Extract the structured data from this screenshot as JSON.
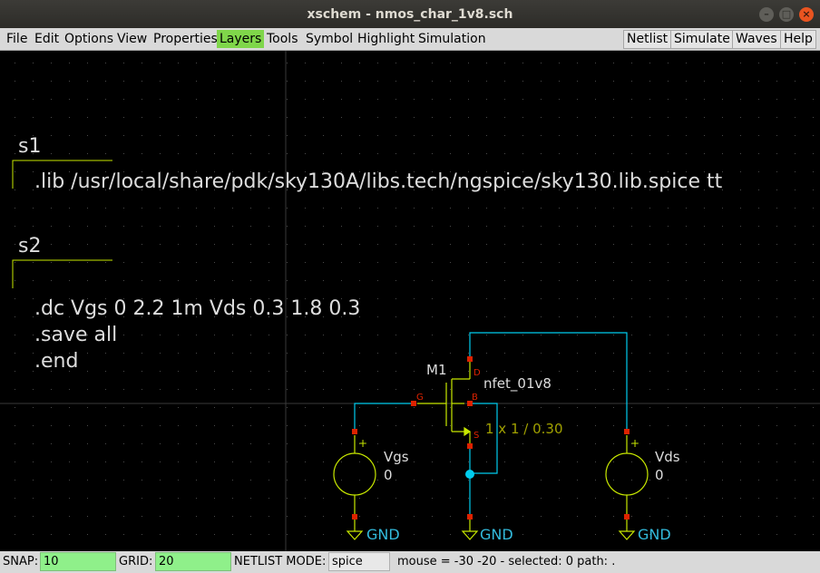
{
  "window": {
    "title": "xschem - nmos_char_1v8.sch"
  },
  "menu": {
    "items": [
      "File",
      "Edit",
      "Options",
      "View",
      "Properties",
      "Layers",
      "Tools",
      "Symbol",
      "Highlight",
      "Simulation"
    ],
    "active": "Layers",
    "right_buttons": [
      "Netlist",
      "Simulate",
      "Waves",
      "Help"
    ]
  },
  "schematic": {
    "code_blocks": [
      {
        "name": "s1",
        "lines": [
          ".lib /usr/local/share/pdk/sky130A/libs.tech/ngspice/sky130.lib.spice tt"
        ]
      },
      {
        "name": "s2",
        "lines": [
          ".dc Vgs 0 2.2 1m Vds 0.3 1.8 0.3",
          ".save all",
          ".end"
        ]
      }
    ],
    "transistor": {
      "name": "M1",
      "model": "nfet_01v8",
      "size": "1 x 1 / 0.30",
      "pins": [
        "D",
        "G",
        "B",
        "S"
      ]
    },
    "sources": [
      {
        "name": "Vgs",
        "value": "0"
      },
      {
        "name": "Vds",
        "value": "0"
      }
    ],
    "ground_label": "GND",
    "colors": {
      "wire": "#00ccee",
      "symbol": "#c8e800",
      "pin": "#dd2200",
      "text": "#dddddd",
      "label": "#33bbdd",
      "size_text": "#a0a000"
    }
  },
  "status": {
    "snap_label": "SNAP:",
    "snap_value": "10",
    "grid_label": "GRID:",
    "grid_value": "20",
    "netlist_label": "NETLIST MODE:",
    "netlist_value": "spice",
    "info": "mouse = -30 -20 - selected: 0 path: ."
  }
}
